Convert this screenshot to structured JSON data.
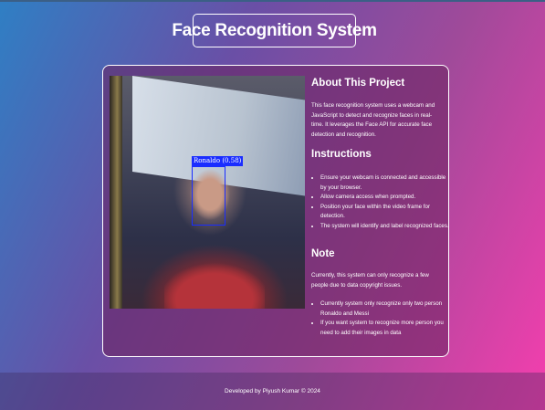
{
  "header": {
    "title": "Face Recognition System"
  },
  "video": {
    "detection_label": "Ronaldo (0.58)",
    "box_color": "#1a2dff"
  },
  "about": {
    "heading": "About This Project",
    "text": "This face recognition system uses a webcam and JavaScript to detect and recognize faces in real-time. It leverages the Face API for accurate face detection and recognition."
  },
  "instructions": {
    "heading": "Instructions",
    "items": [
      "Ensure your webcam is connected and accessible by your browser.",
      "Allow camera access when prompted.",
      "Position your face within the video frame for detection.",
      "The system will identify and label recognized faces."
    ]
  },
  "note": {
    "heading": "Note",
    "text": "Currently, this system can only recognize a few people due to data copyright issues.",
    "items": [
      "Currently system only recognize only two person Ronaldo and Messi",
      "If you want system to recognize more person you need to add their images in data"
    ]
  },
  "footer": {
    "text": "Developed by Piyush Kumar © 2024"
  }
}
